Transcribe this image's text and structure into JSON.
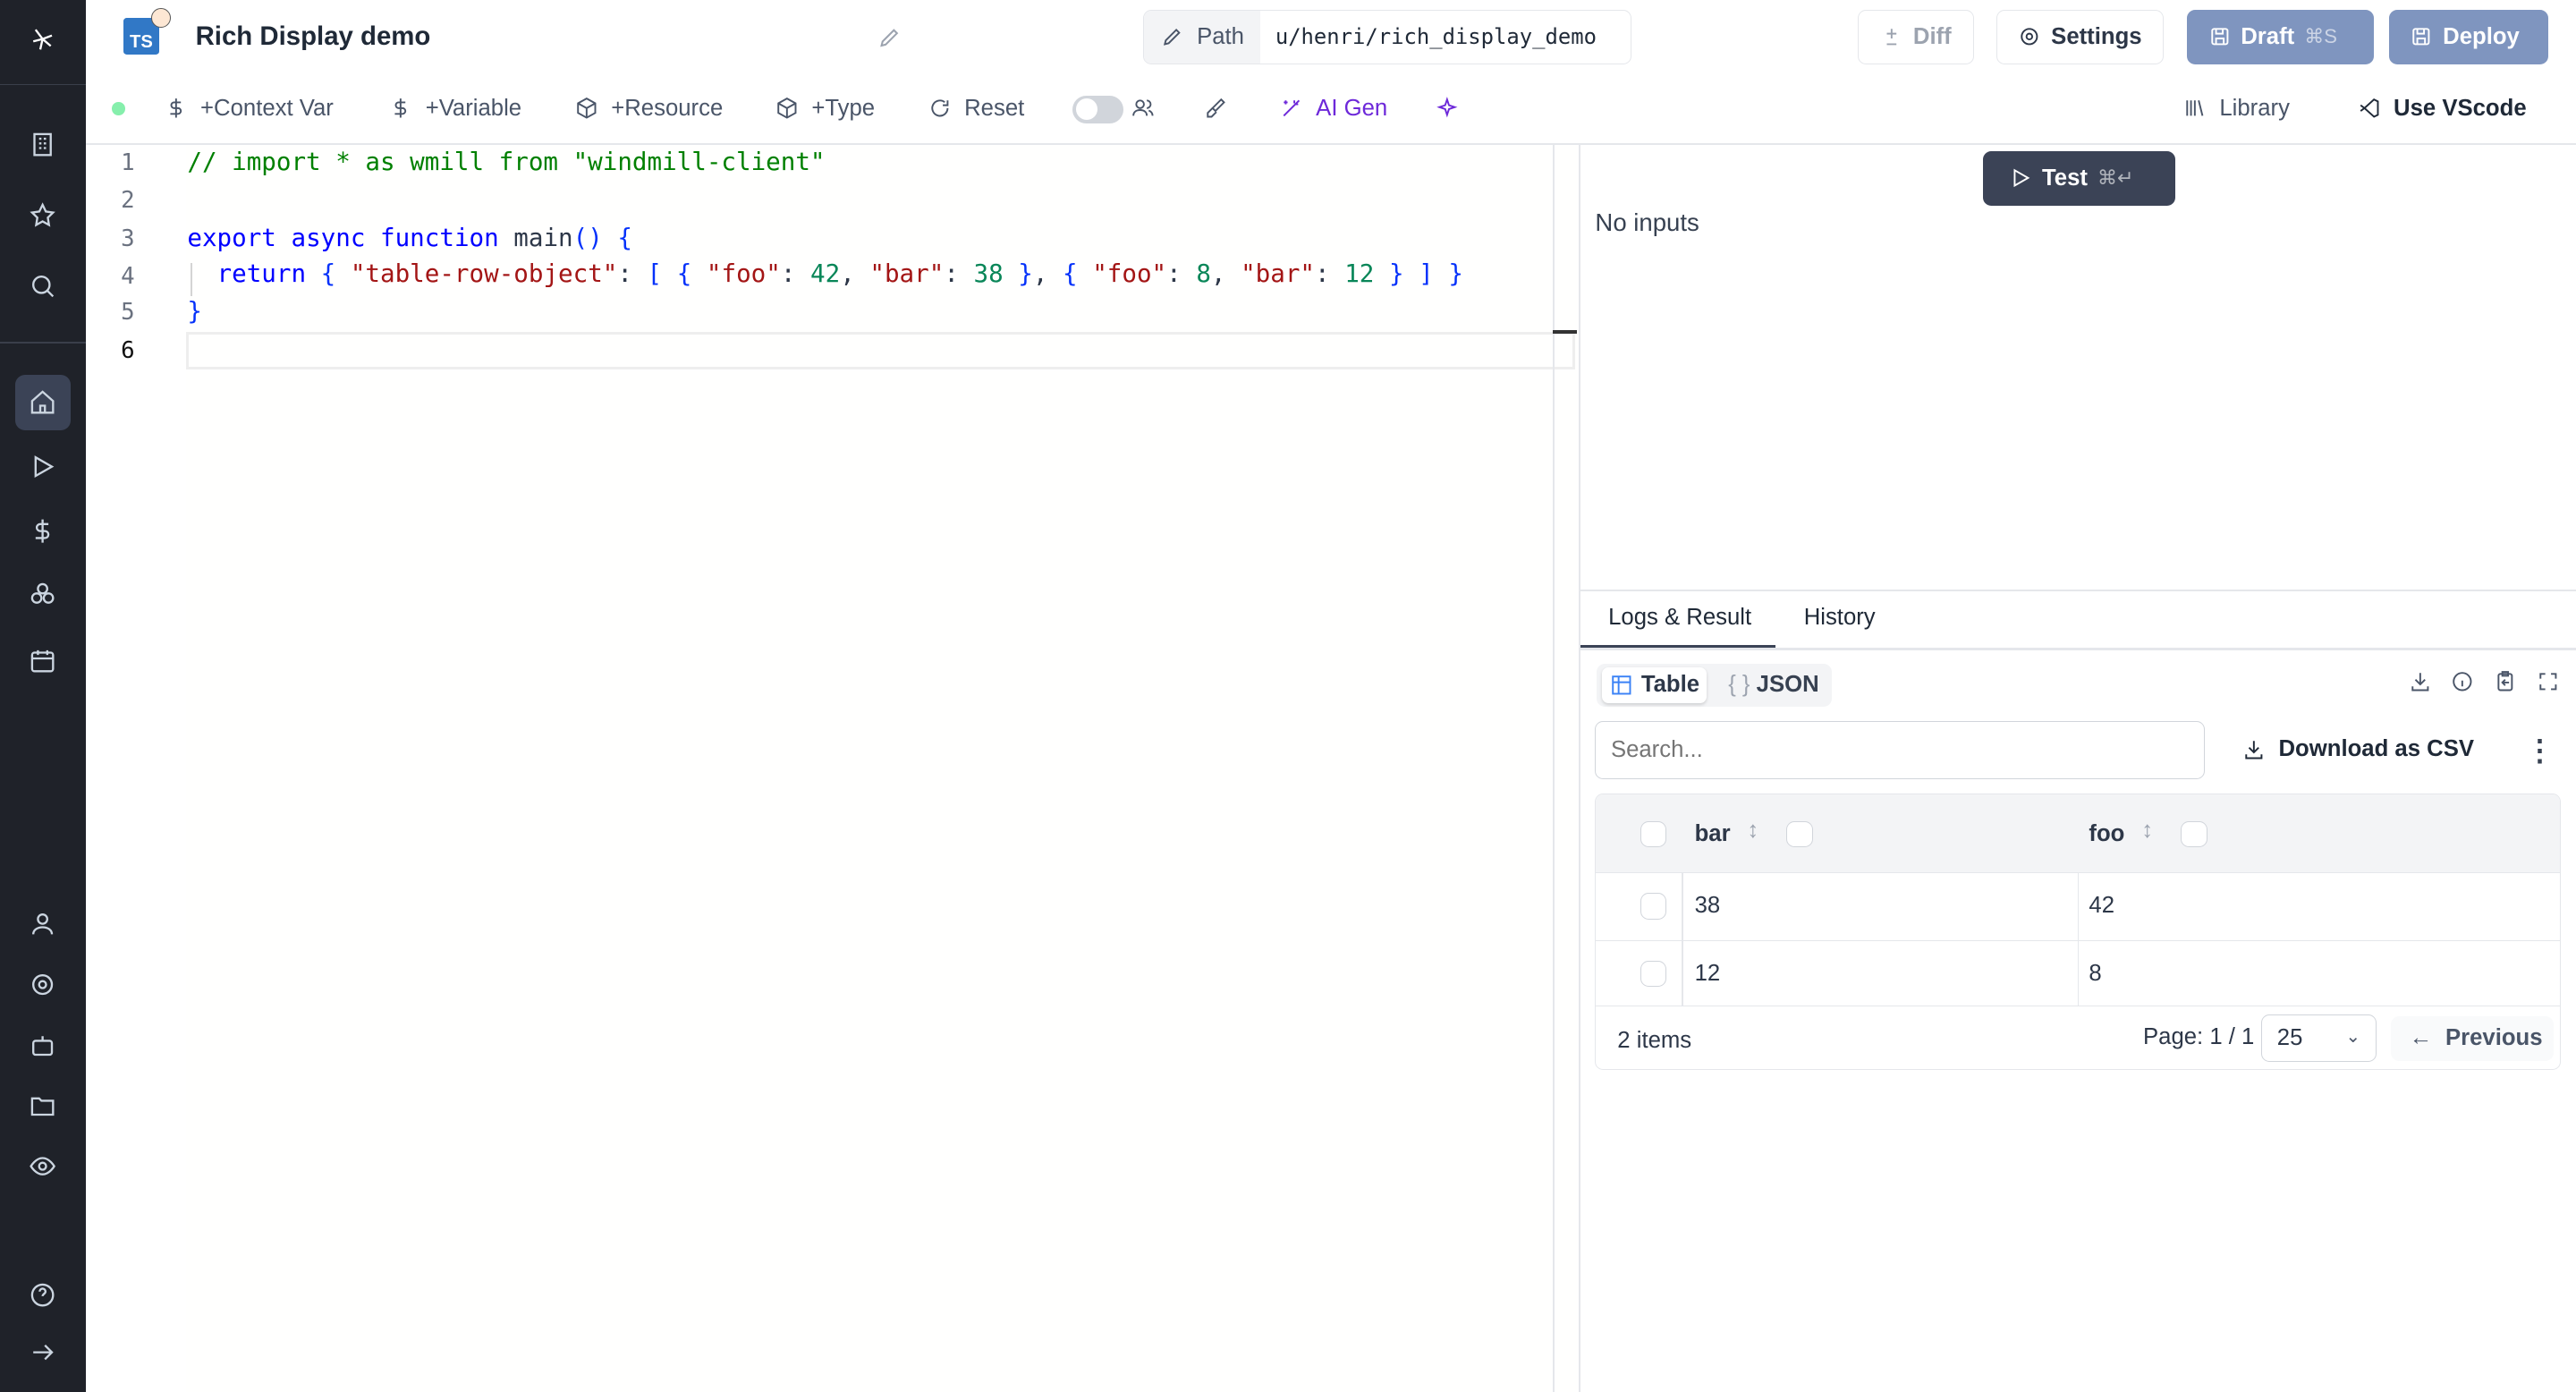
{
  "header": {
    "title": "Rich Display demo",
    "lang_badge": "TS",
    "path_label": "Path",
    "path_value": "u/henri/rich_display_demo",
    "diff": "Diff",
    "settings": "Settings",
    "draft": "Draft",
    "draft_shortcut": "⌘S",
    "deploy": "Deploy"
  },
  "toolbar": {
    "context_var": "+Context Var",
    "variable": "+Variable",
    "resource": "+Resource",
    "type": "+Type",
    "reset": "Reset",
    "ai_gen": "AI Gen",
    "library": "Library",
    "use_vscode": "Use VScode"
  },
  "editor": {
    "line_numbers": [
      "1",
      "2",
      "3",
      "4",
      "5",
      "6"
    ],
    "lines": [
      "// import * as wmill from \"windmill-client\"",
      "",
      "export async function main() {",
      "  return { \"table-row-object\": [ { \"foo\": 42, \"bar\": 38 }, { \"foo\": 8, \"bar\": 12 } ] }",
      "}",
      ""
    ]
  },
  "right": {
    "test": "Test",
    "test_shortcut": "⌘↵",
    "no_inputs": "No inputs",
    "tabs": [
      "Logs & Result",
      "History"
    ],
    "view_table": "Table",
    "view_json": "JSON",
    "search_placeholder": "Search...",
    "download_csv": "Download as CSV",
    "table": {
      "columns": [
        "bar",
        "foo"
      ],
      "rows": [
        [
          "38",
          "42"
        ],
        [
          "12",
          "8"
        ]
      ],
      "items": "2 items",
      "page": "Page: 1 / 1",
      "page_size": "25",
      "previous": "Previous"
    }
  },
  "colors": {
    "sidebar": "#1f2229",
    "primary": "#3b4356",
    "draft": "#7f95bf",
    "ai": "#6d28d9"
  }
}
